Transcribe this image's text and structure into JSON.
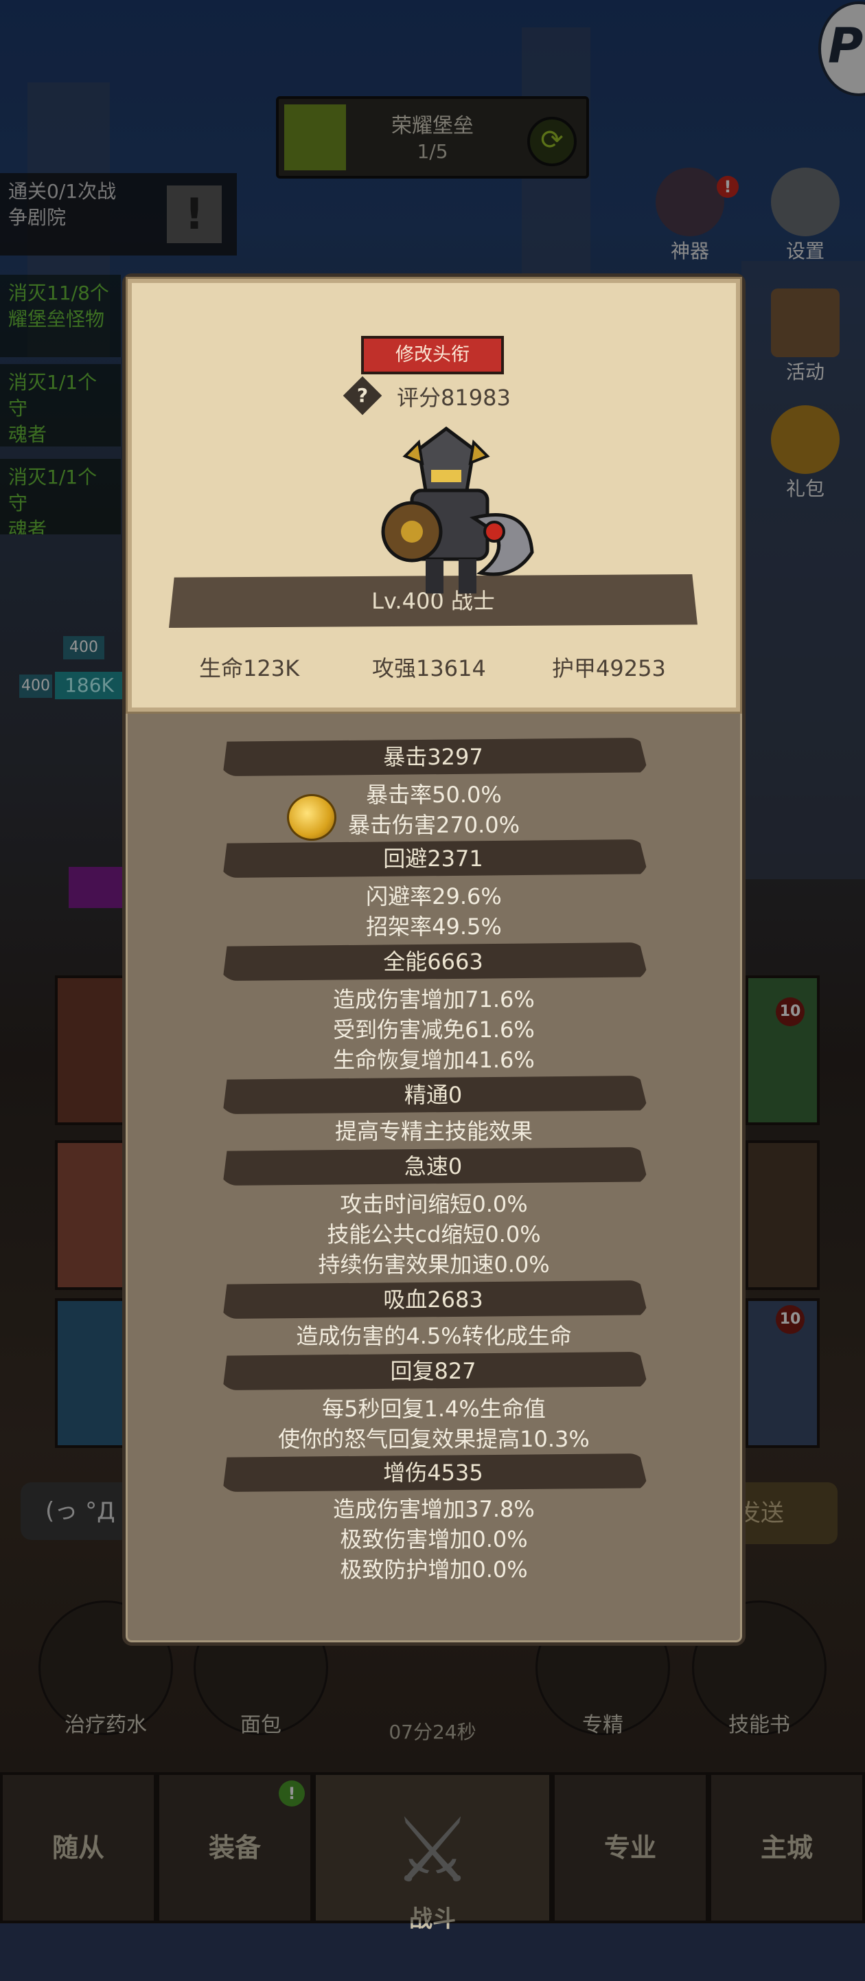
{
  "top": {
    "stage_title": "荣耀堡垒",
    "stage_count": "1/5",
    "refresh_icon": "refresh-icon",
    "stage_progress": 0.2
  },
  "quests": [
    {
      "text": "通关0/1次战\n争剧院"
    },
    {
      "text": "消灭11/8个\n耀堡垒怪物"
    },
    {
      "text": "消灭1/1个守\n魂者"
    },
    {
      "text": "消灭1/1个守\n魂者"
    }
  ],
  "side_buttons": {
    "artifact": "神器",
    "settings": "设置",
    "activity": "活动",
    "gift": "礼包"
  },
  "panel": {
    "change_title_button": "修改头衔",
    "score_label": "评分81983",
    "level_class": "Lv.400 战士",
    "base_stats": [
      "生命123K",
      "攻强13614",
      "护甲49253"
    ],
    "categories": [
      {
        "name": "暴击3297",
        "lines": [
          "暴击率50.0%",
          "暴击伤害270.0%"
        ]
      },
      {
        "name": "回避2371",
        "lines": [
          "闪避率29.6%",
          "招架率49.5%"
        ]
      },
      {
        "name": "全能6663",
        "lines": [
          "造成伤害增加71.6%",
          "受到伤害减免61.6%",
          "生命恢复增加41.6%"
        ]
      },
      {
        "name": "精通0",
        "lines": [
          "提高专精主技能效果"
        ]
      },
      {
        "name": "急速0",
        "lines": [
          "攻击时间缩短0.0%",
          "技能公共cd缩短0.0%",
          "持续伤害效果加速0.0%"
        ]
      },
      {
        "name": "吸血2683",
        "lines": [
          "造成伤害的4.5%转化成生命"
        ]
      },
      {
        "name": "回复827",
        "lines": [
          "每5秒回复1.4%生命值",
          "使你的怒气回复效果提高10.3%"
        ]
      },
      {
        "name": "增伤4535",
        "lines": [
          "造成伤害增加37.8%",
          "极致伤害增加0.0%",
          "极致防护增加0.0%"
        ]
      }
    ]
  },
  "behind": {
    "chat_placeholder": "(っ °Д",
    "send_label": "发送",
    "unit_level_1": "400",
    "unit_level_2": "400",
    "unit_hp": "186K",
    "slot_badge": "10"
  },
  "bottom_items": {
    "potion": "治疗药水",
    "bread": "面包",
    "spec": "专精",
    "skillbook": "技能书",
    "timer": "07分24秒"
  },
  "nav": {
    "follower": "随从",
    "equipment": "装备",
    "battle": "战斗",
    "profession": "专业",
    "city": "主城",
    "equipment_badge": "!"
  },
  "colors": {
    "panel_bg": "#7e7160",
    "card_bg": "#e6d5b0",
    "button_red": "#c0302a",
    "category_bar": "#3e332a",
    "quest_green": "#6ac23c"
  }
}
